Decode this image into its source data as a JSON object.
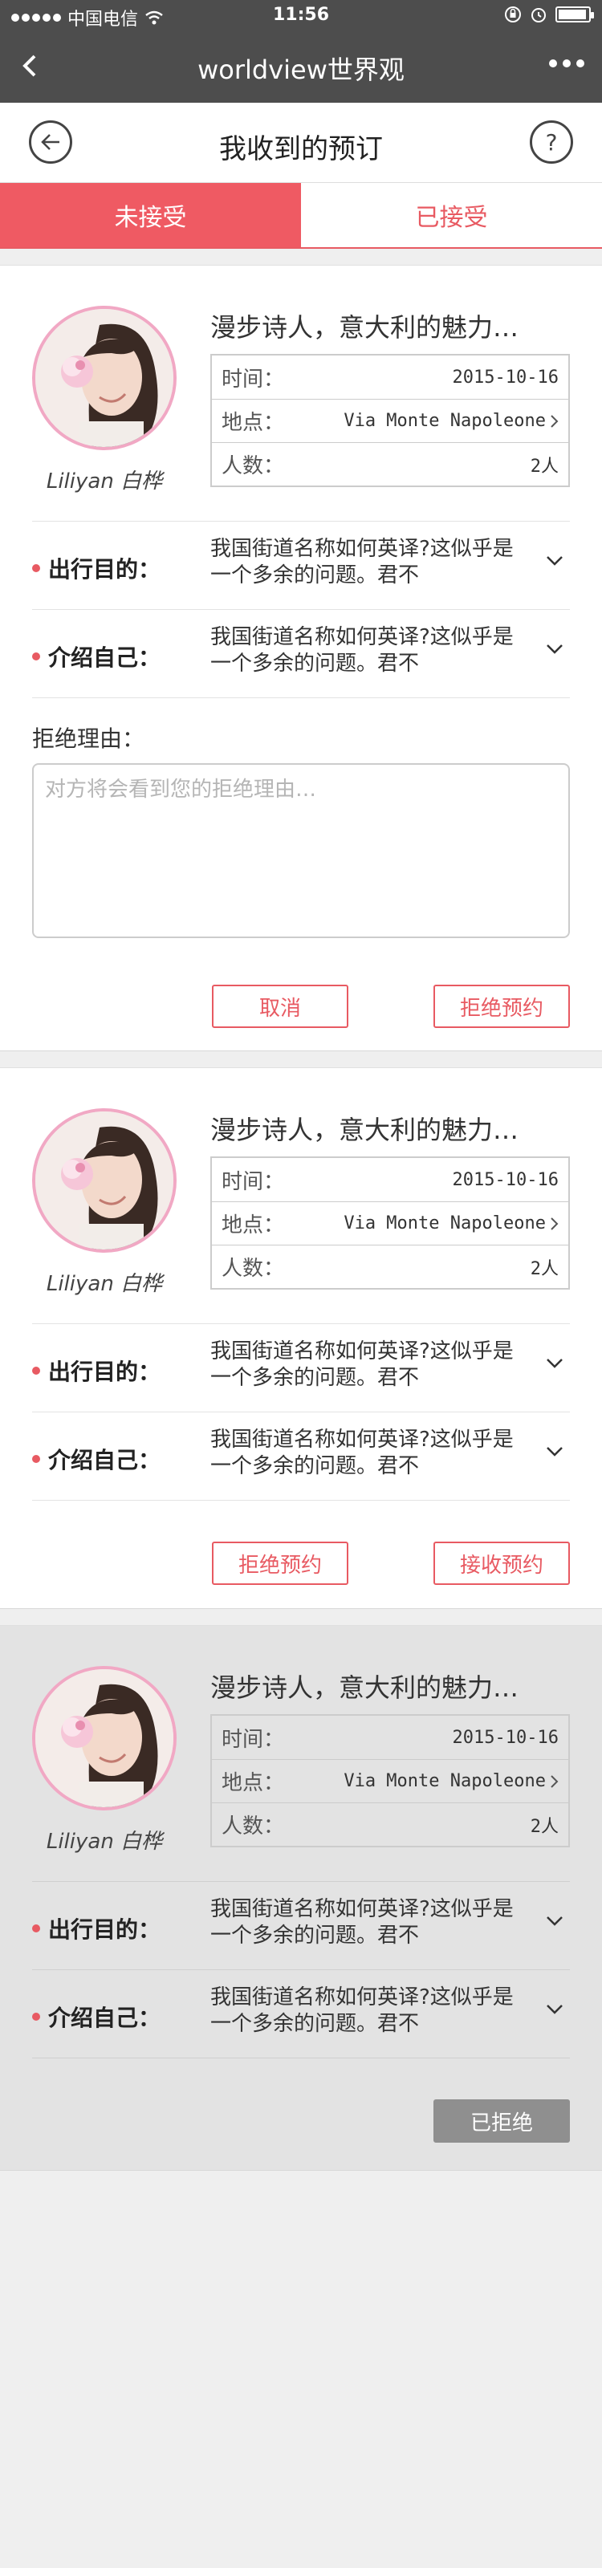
{
  "status_bar": {
    "carrier": "中国电信",
    "time": "11:56"
  },
  "nav": {
    "title": "worldview世界观"
  },
  "page": {
    "title": "我收到的预订",
    "help_glyph": "?"
  },
  "tabs": [
    {
      "label": "未接受",
      "active": true
    },
    {
      "label": "已接受",
      "active": false
    }
  ],
  "cards": [
    {
      "title": "漫步诗人，意大利的魅力…",
      "user": "Liliyan 白桦",
      "rows": [
        {
          "label": "时间：",
          "value": "2015-10-16"
        },
        {
          "label": "地点：",
          "value": "Via Monte Napoleone"
        },
        {
          "label": "人数：",
          "value": "2人"
        }
      ],
      "purpose_label": "出行目的：",
      "purpose_text": "我国街道名称如何英译?这似乎是一个多余的问题。君不",
      "intro_label": "介绍自己：",
      "intro_text": "我国街道名称如何英译?这似乎是一个多余的问题。君不",
      "reason_label": "拒绝理由：",
      "reason_placeholder": "对方将会看到您的拒绝理由…",
      "buttons": [
        "取消",
        "拒绝预约"
      ]
    },
    {
      "title": "漫步诗人，意大利的魅力…",
      "user": "Liliyan 白桦",
      "rows": [
        {
          "label": "时间：",
          "value": "2015-10-16"
        },
        {
          "label": "地点：",
          "value": "Via Monte Napoleone"
        },
        {
          "label": "人数：",
          "value": "2人"
        }
      ],
      "purpose_label": "出行目的：",
      "purpose_text": "我国街道名称如何英译?这似乎是一个多余的问题。君不",
      "intro_label": "介绍自己：",
      "intro_text": "我国街道名称如何英译?这似乎是一个多余的问题。君不",
      "buttons": [
        "拒绝预约",
        "接收预约"
      ]
    },
    {
      "title": "漫步诗人，意大利的魅力…",
      "user": "Liliyan 白桦",
      "rows": [
        {
          "label": "时间：",
          "value": "2015-10-16"
        },
        {
          "label": "地点：",
          "value": "Via Monte Napoleone"
        },
        {
          "label": "人数：",
          "value": "2人"
        }
      ],
      "purpose_label": "出行目的：",
      "purpose_text": "我国街道名称如何英译?这似乎是一个多余的问题。君不",
      "intro_label": "介绍自己：",
      "intro_text": "我国街道名称如何英译?这似乎是一个多余的问题。君不",
      "status_button": "已拒绝"
    }
  ],
  "colors": {
    "accent": "#ef5a63",
    "navbar": "#4d4d4d",
    "avatar_border": "#f1a8c4",
    "rejected_card_bg": "#e3e3e3"
  }
}
